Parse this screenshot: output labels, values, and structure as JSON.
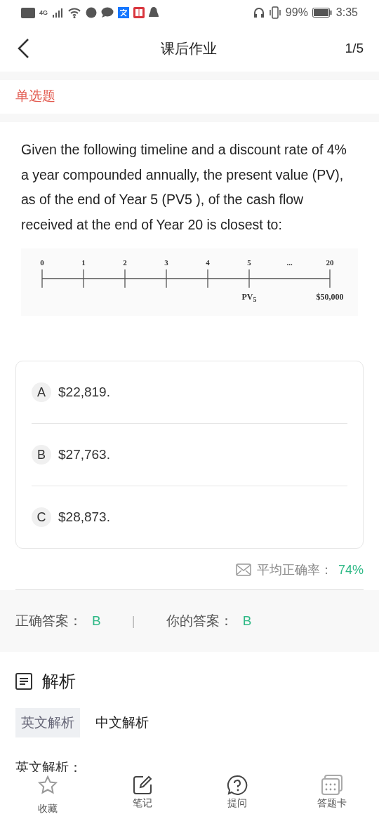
{
  "status_bar": {
    "network": "4G",
    "battery": "99%",
    "time": "3:35"
  },
  "header": {
    "title": "课后作业",
    "progress": "1/5"
  },
  "question_type": "单选题",
  "question": {
    "text": "Given the following timeline and a discount rate of 4% a year compounded annually, the present value (PV), as of the end of Year 5 (PV5 ), of the cash flow received at the end of Year 20 is closest to:",
    "timeline": {
      "ticks": [
        {
          "label": "0"
        },
        {
          "label": "1"
        },
        {
          "label": "2"
        },
        {
          "label": "3"
        },
        {
          "label": "4"
        },
        {
          "label": "5",
          "below": "PV$_{5}$"
        },
        {
          "label": "20",
          "below": "$50,000"
        }
      ],
      "gap_mark": "..."
    }
  },
  "options": [
    {
      "letter": "A",
      "text": "$22,819."
    },
    {
      "letter": "B",
      "text": "$27,763."
    },
    {
      "letter": "C",
      "text": "$28,873."
    }
  ],
  "stats": {
    "label": "平均正确率：",
    "value": "74%"
  },
  "answers": {
    "correct_label": "正确答案：",
    "correct": "B",
    "separator": "|",
    "yours_label": "你的答案：",
    "yours": "B"
  },
  "analysis": {
    "title": "解析",
    "tabs": [
      {
        "label": "英文解析",
        "selected": true
      },
      {
        "label": "中文解析",
        "selected": false
      }
    ],
    "section_label": "英文解析："
  },
  "bottom_nav": [
    {
      "kind": "star",
      "label": "收藏"
    },
    {
      "kind": "note",
      "label": "笔记"
    },
    {
      "kind": "ask",
      "label": "提问"
    },
    {
      "kind": "card",
      "label": "答题卡"
    }
  ]
}
